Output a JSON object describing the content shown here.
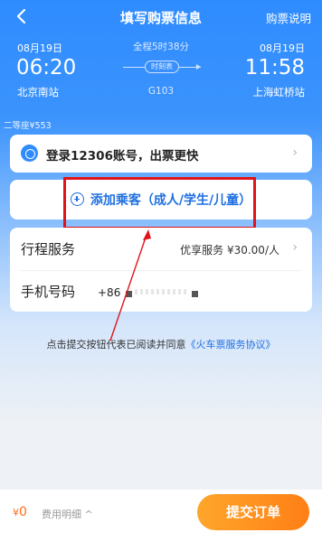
{
  "nav": {
    "title": "填写购票信息",
    "right_link": "购票说明"
  },
  "journey": {
    "depart_date": "08月19日",
    "arrive_date": "08月19日",
    "depart_time": "06:20",
    "arrive_time": "11:58",
    "depart_station": "北京南站",
    "arrive_station": "上海虹桥站",
    "duration": "全程5时38分",
    "timetable_label": "时刻表",
    "train_no": "G103",
    "seat_info": "二等座¥553"
  },
  "login_card": {
    "text": "登录12306账号，出票更快",
    "chevron": "›"
  },
  "add_passenger": {
    "label": "添加乘客（成人/学生/儿童）"
  },
  "service": {
    "label": "行程服务",
    "value": "优享服务 ¥30.00/人",
    "chevron": "›"
  },
  "phone": {
    "label": "手机号码",
    "country_code": "+86"
  },
  "agreement": {
    "prefix": "点击提交按钮代表已阅读并同意",
    "link": "《火车票服务协议》"
  },
  "bottom_bar": {
    "currency": "¥",
    "price": "0",
    "fee_detail": "费用明细 ^",
    "submit": "提交订单"
  },
  "colors": {
    "brand_blue": "#2f8cff",
    "link_blue": "#1f6fe0",
    "annotation_red": "#e0131b",
    "submit_orange": "#ff7f16"
  }
}
